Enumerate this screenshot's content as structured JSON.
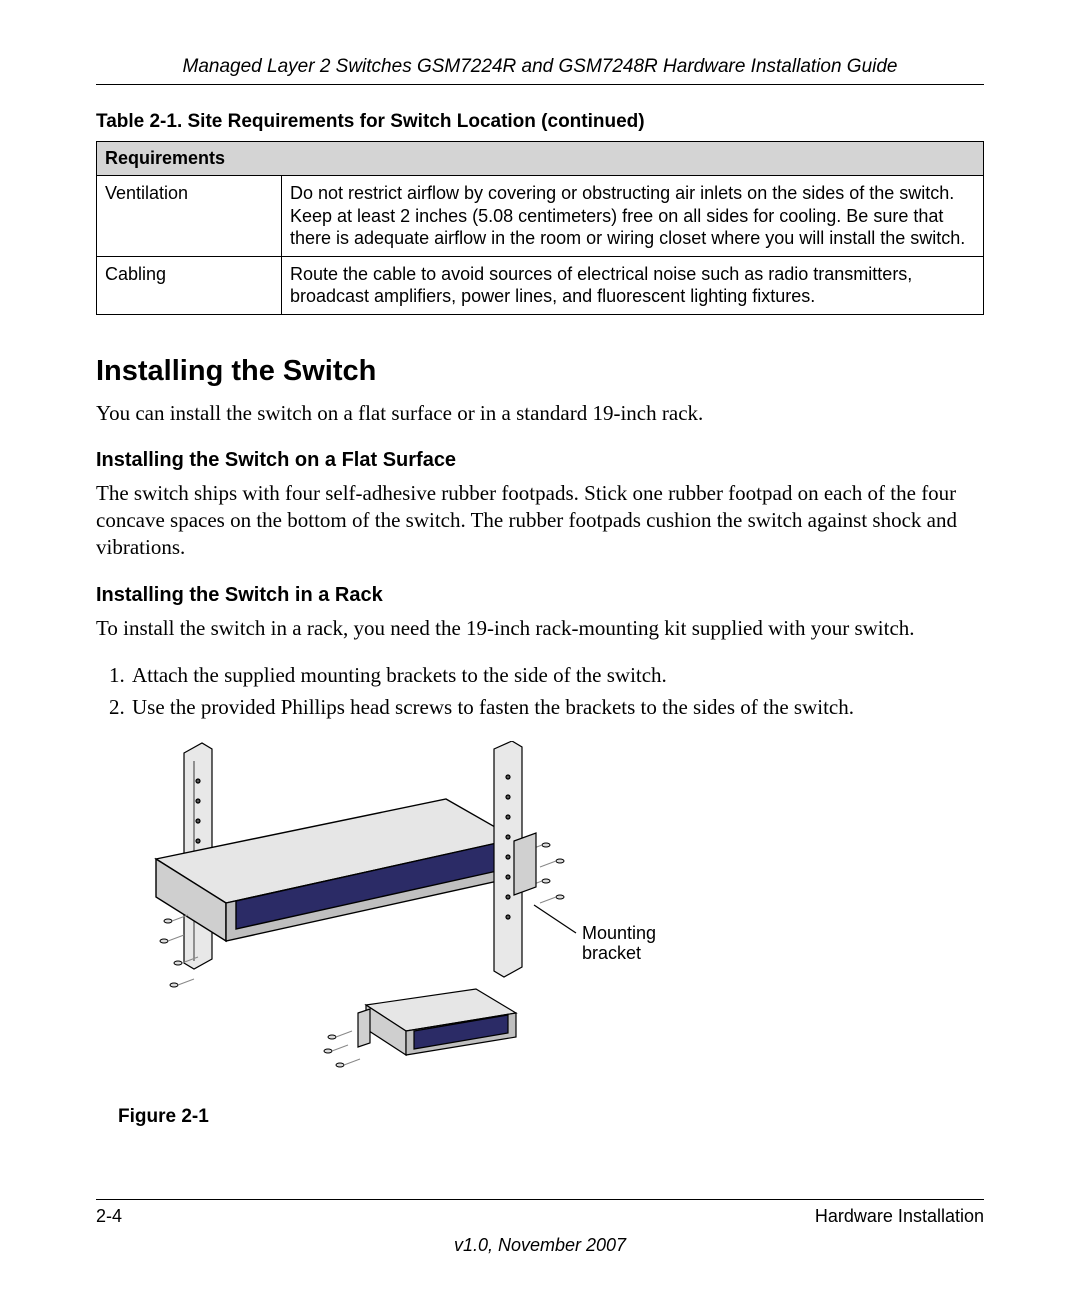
{
  "header": {
    "title": "Managed Layer 2 Switches GSM7224R and GSM7248R Hardware Installation Guide"
  },
  "table": {
    "caption": "Table 2-1.  Site Requirements for Switch Location  (continued)",
    "header": "Requirements",
    "rows": [
      {
        "label": "Ventilation",
        "desc": "Do not restrict airflow by covering or obstructing air inlets on the sides of the switch. Keep at least 2 inches (5.08 centimeters) free on all sides for cooling. Be sure that there is adequate airflow in the room or wiring closet where you will install the switch."
      },
      {
        "label": "Cabling",
        "desc": "Route the cable to avoid sources of electrical noise such as radio transmitters, broadcast amplifiers, power lines, and fluorescent lighting fixtures."
      }
    ]
  },
  "section": {
    "heading": "Installing the Switch",
    "intro": "You can install the switch on a flat surface or in a standard 19-inch rack.",
    "flat": {
      "heading": "Installing the Switch on a Flat Surface",
      "body": "The switch ships with four self-adhesive rubber footpads. Stick one rubber footpad on each of the four concave spaces on the bottom of the switch. The rubber footpads cushion the switch against shock and vibrations."
    },
    "rack": {
      "heading": "Installing the Switch in a Rack",
      "body": "To install the switch in a rack, you need the 19-inch rack-mounting kit supplied with your switch.",
      "steps": [
        "Attach the supplied mounting brackets to the side of the switch.",
        "Use the provided Phillips head screws to fasten the brackets to the sides of the switch."
      ]
    }
  },
  "figure": {
    "caption": "Figure 2-1",
    "callout_line1": "Mounting",
    "callout_line2": "bracket"
  },
  "footer": {
    "page": "2-4",
    "section": "Hardware Installation",
    "version": "v1.0, November 2007"
  }
}
